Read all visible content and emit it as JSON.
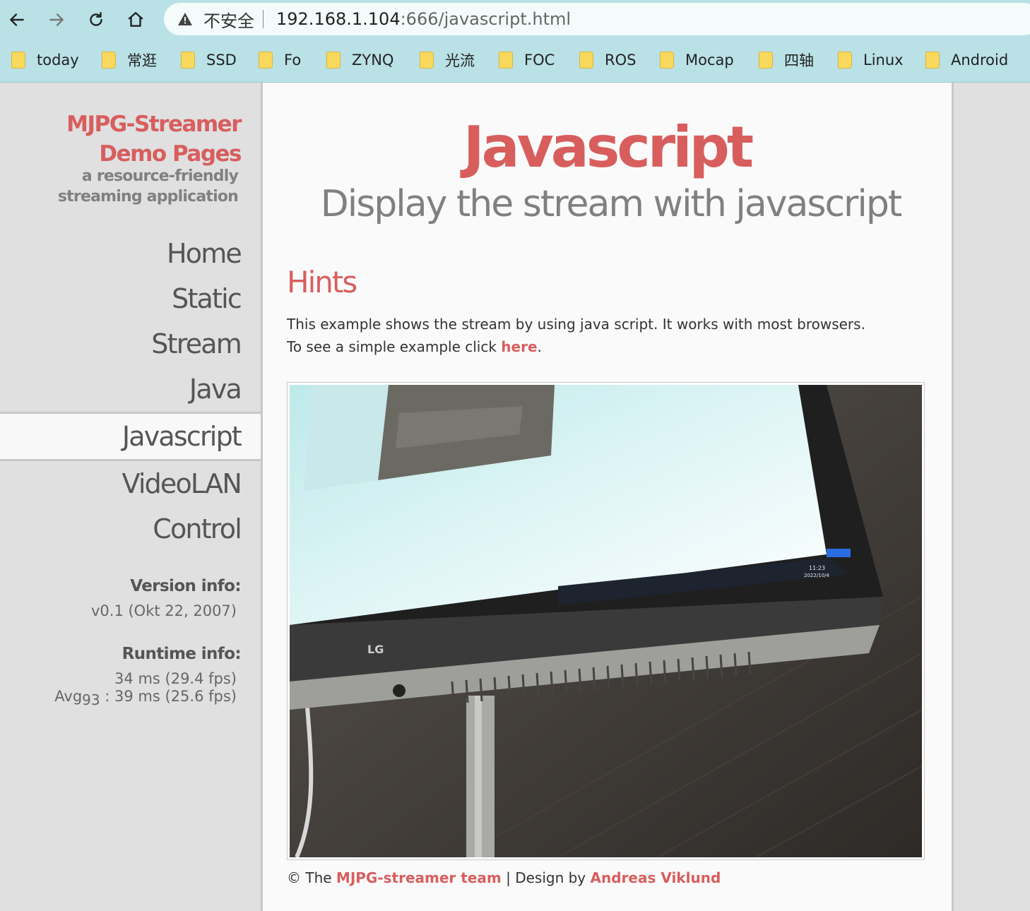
{
  "browser": {
    "insecure_label": "不安全",
    "url_host": "192.168.1.104",
    "url_path": ":666/javascript.html",
    "bookmarks": [
      "today",
      "常逛",
      "SSD",
      "Fo",
      "ZYNQ",
      "光流",
      "FOC",
      "ROS",
      "Mocap",
      "四轴",
      "Linux",
      "Android"
    ]
  },
  "sidebar": {
    "brand_line1": "MJPG-Streamer",
    "brand_line2": "Demo Pages",
    "tagline_line1": "a resource-friendly",
    "tagline_line2": "streaming application",
    "menu": [
      "Home",
      "Static",
      "Stream",
      "Java",
      "Javascript",
      "VideoLAN",
      "Control"
    ],
    "active_menu": "Javascript",
    "version_heading": "Version info:",
    "version_value": "v0.1 (Okt 22, 2007)",
    "runtime_heading": "Runtime info:",
    "runtime_line1": "34 ms (29.4 fps)",
    "avg_label": "Avg",
    "avg_sub": "93",
    "runtime_line2": " : 39 ms (25.6 fps)"
  },
  "main": {
    "title": "Javascript",
    "subtitle": "Display the stream with javascript",
    "hints_heading": "Hints",
    "para_line1": "This example shows the stream by using java script. It works with most browsers.",
    "para_line2_prefix": "To see a simple example click ",
    "para_link": "here",
    "para_line2_suffix": ".",
    "footer_prefix": "© The ",
    "footer_team": "MJPG-streamer team",
    "footer_mid": " | Design by ",
    "footer_designer": "Andreas Viklund"
  },
  "stream_image": {
    "brand_text": "LG",
    "clock_time": "11:23",
    "clock_date": "2022/10/4"
  },
  "colors": {
    "accent": "#d85e5e",
    "sidebar_bg": "#e0e0e0",
    "content_bg": "#fafafa",
    "chrome_bg": "#b9e1e6"
  }
}
